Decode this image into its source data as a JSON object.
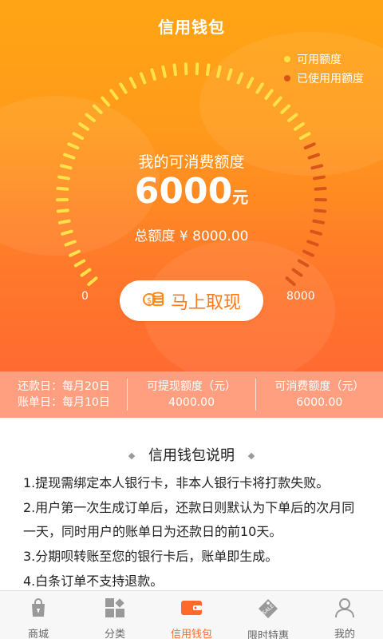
{
  "header": {
    "title": "信用钱包"
  },
  "legend": [
    {
      "label": "可用额度",
      "color": "#ffe24a"
    },
    {
      "label": "已使用用额度",
      "color": "#d9541a"
    }
  ],
  "gauge": {
    "label": "我的可消费额度",
    "amount": "6000",
    "unit": "元",
    "total_label": "总额度 ¥ 8000.00",
    "min_label": "0",
    "max_label": "8000",
    "available_fraction": 0.75,
    "available_color": "#ffe24a",
    "used_color": "#d9541a"
  },
  "withdraw_button": {
    "label": "马上取现",
    "icon": "coin-stack-icon"
  },
  "info": {
    "repay_day": "还款日：每月20日",
    "bill_day": "账单日：每月10日",
    "withdrawable_label": "可提现额度（元）",
    "withdrawable_value": "4000.00",
    "consumable_label": "可消费额度（元）",
    "consumable_value": "6000.00"
  },
  "description": {
    "title": "信用钱包说明",
    "items": [
      "1.提现需绑定本人银行卡，非本人银行卡将打款失败。",
      "2.用户第一次生成订单后，还款日则默认为下单后的次月同一天，同时用户的账单日为还款日的前10天。",
      "3.分期呗转账至您的银行卡后，账单即生成。",
      "4.白条订单不支持退款。"
    ]
  },
  "tabbar": [
    {
      "label": "商城",
      "icon": "shopping-bag-icon",
      "active": false
    },
    {
      "label": "分类",
      "icon": "grid-category-icon",
      "active": false
    },
    {
      "label": "信用钱包",
      "icon": "wallet-icon",
      "active": true
    },
    {
      "label": "限时特惠",
      "icon": "sale-tag-icon",
      "active": false
    },
    {
      "label": "我的",
      "icon": "user-icon",
      "active": false
    }
  ],
  "colors": {
    "accent": "#ff6a2a",
    "hero_top": "#ffa514",
    "hero_bottom": "#ff6a30"
  }
}
